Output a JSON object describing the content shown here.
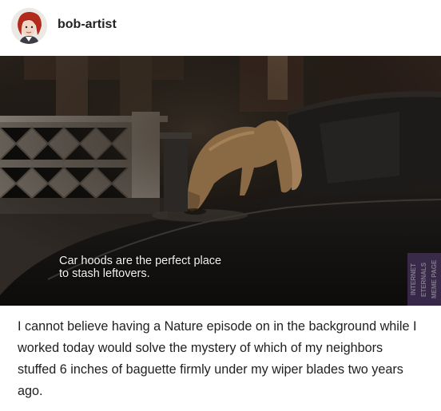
{
  "post": {
    "author": "bob-artist",
    "avatar_icon": "avatar-illustration-icon"
  },
  "image": {
    "subtitle_lines": [
      "Car hoods are the perfect place",
      "to stash leftovers."
    ],
    "watermark_lines": [
      "INTERNET",
      "ETERNALS",
      "MEME PAGE"
    ]
  },
  "caption": {
    "lines": [
      "I cannot believe having a Nature episode on in the background while I",
      "worked today would solve the mystery of which of my neighbors",
      "stuffed 6 inches of baguette firmly under my wiper blades two years",
      "ago."
    ]
  }
}
